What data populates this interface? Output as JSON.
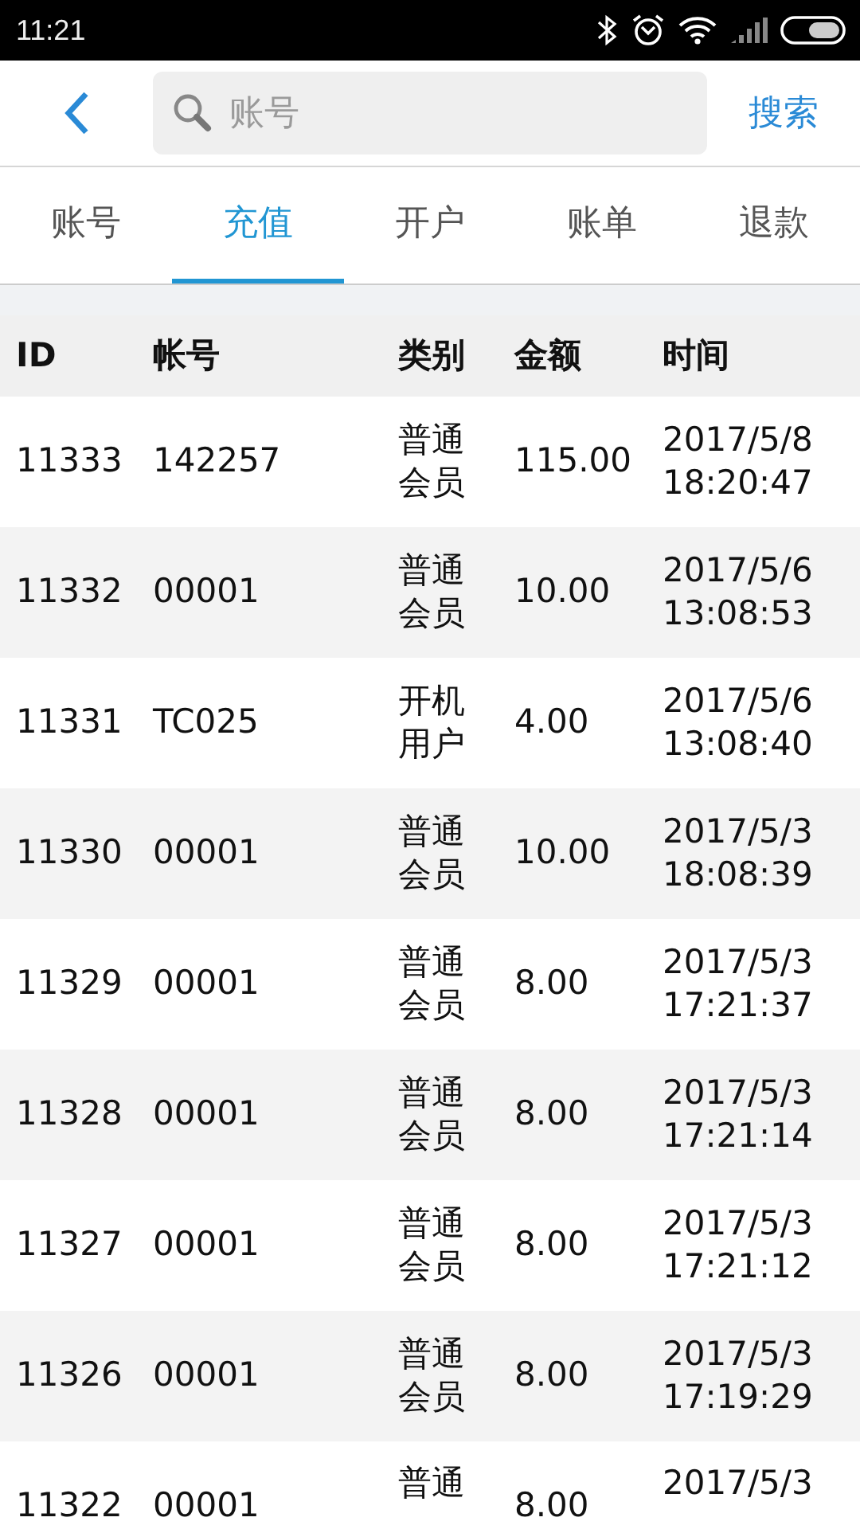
{
  "status_bar": {
    "time": "11:21"
  },
  "search": {
    "placeholder": "账号",
    "button": "搜索"
  },
  "tabs": [
    {
      "label": "账号",
      "selected": false
    },
    {
      "label": "充值",
      "selected": true
    },
    {
      "label": "开户",
      "selected": false
    },
    {
      "label": "账单",
      "selected": false
    },
    {
      "label": "退款",
      "selected": false
    }
  ],
  "table": {
    "columns": [
      "ID",
      "帐号",
      "类别",
      "金额",
      "时间"
    ],
    "rows": [
      [
        "11333",
        "142257",
        "普通会员",
        "115.00",
        "2017/5/8 18:20:47"
      ],
      [
        "11332",
        "00001",
        "普通会员",
        "10.00",
        "2017/5/6 13:08:53"
      ],
      [
        "11331",
        "TC025",
        "开机用户",
        "4.00",
        "2017/5/6 13:08:40"
      ],
      [
        "11330",
        "00001",
        "普通会员",
        "10.00",
        "2017/5/3 18:08:39"
      ],
      [
        "11329",
        "00001",
        "普通会员",
        "8.00",
        "2017/5/3 17:21:37"
      ],
      [
        "11328",
        "00001",
        "普通会员",
        "8.00",
        "2017/5/3 17:21:14"
      ],
      [
        "11327",
        "00001",
        "普通会员",
        "8.00",
        "2017/5/3 17:21:12"
      ],
      [
        "11326",
        "00001",
        "普通会员",
        "8.00",
        "2017/5/3 17:19:29"
      ],
      [
        "11322",
        "00001",
        "普通",
        "8.00",
        "2017/5/3"
      ]
    ]
  }
}
